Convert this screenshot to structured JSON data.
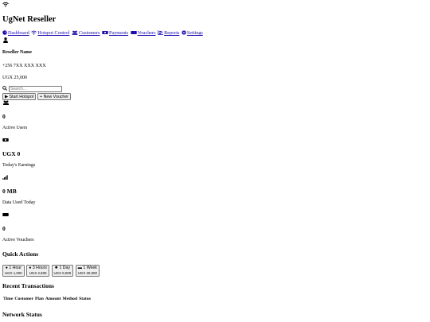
{
  "header": {
    "app_title": "UgNet Reseller"
  },
  "nav": {
    "dashboard": "Dashboard",
    "hotspot_control": "Hotspot Control",
    "customers": "Customers",
    "payments": "Payments",
    "vouchers": "Vouchers",
    "reports": "Reports",
    "settings": "Settings"
  },
  "profile": {
    "name": "Reseller Name",
    "phone": "+256 7XX XXX XXX",
    "balance": "UGX 25,000"
  },
  "toolbar": {
    "search_placeholder": "Search...",
    "start_hotspot": "Start Hotspot",
    "new_voucher": "New Voucher"
  },
  "stats": {
    "active_users_value": "0",
    "active_users_label": "Active Users",
    "earnings_value": "UGX 0",
    "earnings_label": "Today's Earnings",
    "data_value": "0 MB",
    "data_label": "Data Used Today",
    "vouchers_value": "0",
    "vouchers_label": "Active Vouchers"
  },
  "quick_actions": {
    "title": "Quick Actions",
    "items": [
      {
        "label": "1 Hour",
        "price": "UGX 1,000",
        "icon": "clock-icon"
      },
      {
        "label": "3 Hours",
        "price": "UGX 2,500",
        "icon": "clock-icon"
      },
      {
        "label": "1 Day",
        "price": "UGX 5,000",
        "icon": "sun-icon"
      },
      {
        "label": "1 Week",
        "price": "UGX 20,000",
        "icon": "calendar-week-icon"
      }
    ]
  },
  "transactions": {
    "title": "Recent Transactions",
    "columns": [
      "Time",
      "Customer",
      "Plan",
      "Amount",
      "Method",
      "Status"
    ]
  },
  "network": {
    "title": "Network Status"
  },
  "colors": {
    "link": "#1a0dab",
    "text": "#000000",
    "button_bg": "#efefef"
  }
}
